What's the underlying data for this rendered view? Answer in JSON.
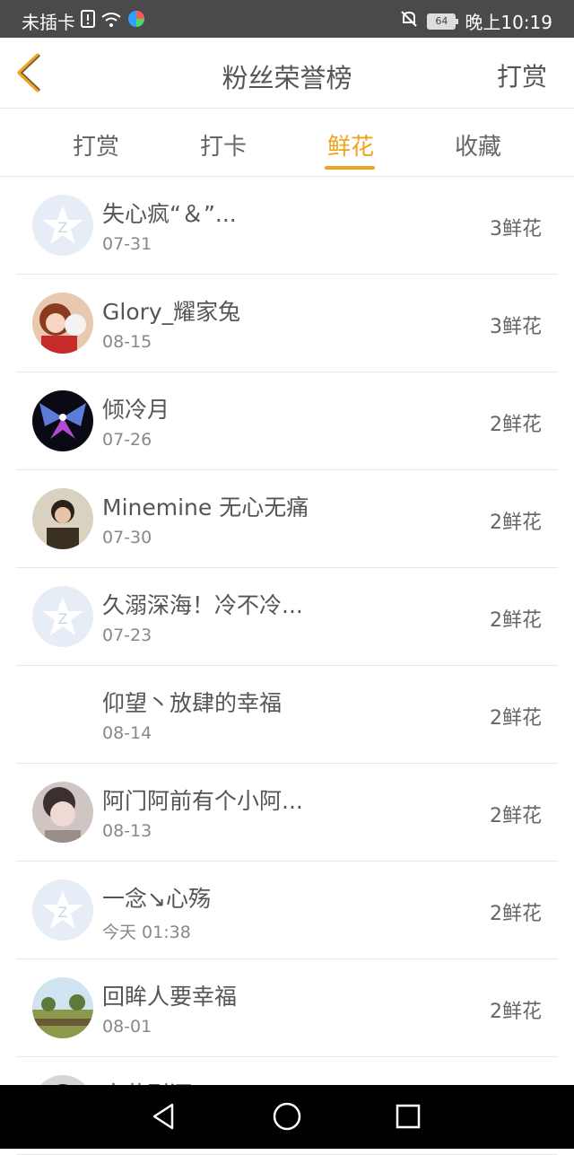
{
  "status": {
    "carrier": "未插卡",
    "battery": "64",
    "time": "晚上10:19"
  },
  "header": {
    "title": "粉丝荣誉榜",
    "right_action": "打赏"
  },
  "tabs": [
    "打赏",
    "打卡",
    "鲜花",
    "收藏"
  ],
  "active_tab": "鲜花",
  "list": [
    {
      "name": "失心疯“＆”...",
      "time": "07-31",
      "flowers": "3鲜花",
      "avatar": "default-avatar-icon"
    },
    {
      "name": "Glory_耀家兔",
      "time": "08-15",
      "flowers": "3鲜花",
      "avatar": "user-photo"
    },
    {
      "name": "倾冷月",
      "time": "07-26",
      "flowers": "2鲜花",
      "avatar": "user-photo"
    },
    {
      "name": "Minemine 无心无痛",
      "time": "07-30",
      "flowers": "2鲜花",
      "avatar": "user-photo"
    },
    {
      "name": "久溺深海！冷不冷...",
      "time": "07-23",
      "flowers": "2鲜花",
      "avatar": "default-avatar-icon"
    },
    {
      "name": "仰望丶放肆的幸福",
      "time": "08-14",
      "flowers": "2鲜花",
      "avatar": "none"
    },
    {
      "name": "阿门阿前有个小阿...",
      "time": "08-13",
      "flowers": "2鲜花",
      "avatar": "user-photo"
    },
    {
      "name": "一念↘心殇",
      "time": "今天 01:38",
      "flowers": "2鲜花",
      "avatar": "default-avatar-icon"
    },
    {
      "name": "回眸人要幸福",
      "time": "08-01",
      "flowers": "2鲜花",
      "avatar": "user-photo"
    },
    {
      "name": "南巷烈酒",
      "time": "",
      "flowers": "",
      "avatar": "user-photo"
    }
  ],
  "colors": {
    "accent": "#f0a31c",
    "status_bar": "#4a4a4a",
    "nav_bar": "#000000",
    "text": "#555555"
  }
}
